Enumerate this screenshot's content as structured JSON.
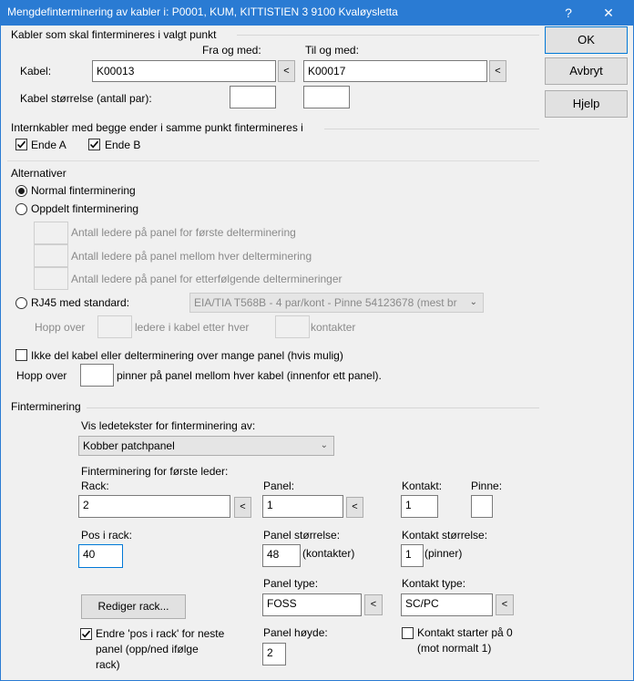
{
  "window": {
    "title": "Mengdefinterminering av kabler i: P0001, KUM, KITTISTIEN 3 9100 Kvaløysletta",
    "help_glyph": "?",
    "close_glyph": "✕"
  },
  "buttons": {
    "ok": "OK",
    "cancel": "Avbryt",
    "help": "Hjelp",
    "pick": "<",
    "edit_rack": "Rediger rack..."
  },
  "cables_group": {
    "title": "Kabler som skal fintermineres i valgt punkt",
    "from_header": "Fra og med:",
    "to_header": "Til og med:",
    "cable_label": "Kabel:",
    "cable_from": "K00013",
    "cable_to": "K00017",
    "size_label": "Kabel størrelse (antall par):",
    "size_from": "",
    "size_to": ""
  },
  "internal_group": {
    "title": "Internkabler med begge ender i samme punkt fintermineres i",
    "end_a": "Ende A",
    "end_b": "Ende B"
  },
  "alternatives": {
    "title": "Alternativer",
    "normal": "Normal finterminering",
    "split": "Oppdelt finterminering",
    "split_first": "Antall ledere på panel for første delterminering",
    "split_between": "Antall ledere på panel mellom hver delterminering",
    "split_following": "Antall ledere på panel for etterfølgende deltermineringer",
    "rj45": "RJ45 med standard:",
    "rj45_standard": "EIA/TIA T568B - 4 par/kont - Pinne 54123678 (mest br",
    "skip_prefix": "Hopp over",
    "skip_middle": "ledere i kabel etter hver",
    "skip_suffix": "kontakter",
    "no_split": "Ikke del kabel eller delterminering over mange panel (hvis mulig)",
    "skip_pins_prefix": "Hopp over",
    "skip_pins_suffix": "pinner på panel mellom hver kabel (innenfor ett panel).",
    "skip_pins_value": ""
  },
  "termination": {
    "title": "Finterminering",
    "show_labels": "Vis ledetekster for finterminering av:",
    "label_type": "Kobber patchpanel",
    "first_conductor": "Finterminering for første leder:",
    "rack_label": "Rack:",
    "rack_value": "2",
    "panel_label": "Panel:",
    "panel_value": "1",
    "contact_label": "Kontakt:",
    "contact_value": "1",
    "pin_label": "Pinne:",
    "pin_value": "",
    "pos_label": "Pos i rack:",
    "pos_value": "40",
    "panel_size_label": "Panel størrelse:",
    "panel_size_value": "48",
    "panel_size_unit": "(kontakter)",
    "contact_size_label": "Kontakt størrelse:",
    "contact_size_value": "1",
    "contact_size_unit": "(pinner)",
    "panel_type_label": "Panel type:",
    "panel_type_value": "FOSS",
    "contact_type_label": "Kontakt type:",
    "contact_type_value": "SC/PC",
    "change_pos_line1": "Endre 'pos i rack' for neste",
    "change_pos_line2": "panel (opp/ned ifølge",
    "change_pos_line3": "rack)",
    "panel_height_label": "Panel høyde:",
    "panel_height_value": "2",
    "contact_zero_line1": "Kontakt starter på 0",
    "contact_zero_line2": "(mot normalt 1)"
  }
}
